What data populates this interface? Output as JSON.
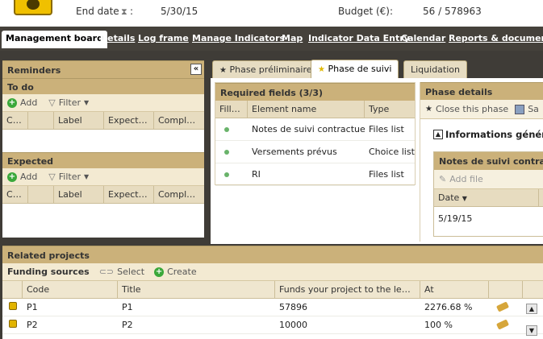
{
  "header": {
    "end_date_label": "End date",
    "end_date_value": "5/30/15",
    "budget_label": "Budget (€):",
    "budget_value": "56 / 578963"
  },
  "nav": {
    "items": [
      "Management board",
      "Details",
      "Log frame",
      "Manage Indicators",
      "Map",
      "Indicator Data Entry",
      "Calendar",
      "Reports & documents"
    ]
  },
  "reminders": {
    "title": "Reminders",
    "collapse_glyph": "«",
    "todo": {
      "title": "To do",
      "add_label": "Add",
      "filter_label": "Filter",
      "columns": [
        "Cl...",
        "",
        "Label",
        "Expecte...",
        "Complet..."
      ]
    },
    "expected": {
      "title": "Expected",
      "add_label": "Add",
      "filter_label": "Filter",
      "columns": [
        "Cl...",
        "",
        "Label",
        "Expecte...",
        "Complet..."
      ]
    }
  },
  "tabs": [
    "Phase préliminaire",
    "Phase de suivi",
    "Liquidation"
  ],
  "required_fields": {
    "title": "Required fields (3/3)",
    "columns": [
      "Fille...",
      "Element name",
      "Type"
    ],
    "rows": [
      {
        "name": "Notes de suivi contractuel",
        "type": "Files list"
      },
      {
        "name": "Versements prévus",
        "type": "Choice list"
      },
      {
        "name": "RI",
        "type": "Files list"
      }
    ]
  },
  "phase_details": {
    "title": "Phase details",
    "close_label": "Close this phase",
    "save_label": "Sa",
    "section_label": "Informations généra",
    "notes_title": "Notes de suivi contractu",
    "add_file_label": "Add file",
    "date_header": "Date",
    "date_value": "5/19/15"
  },
  "related_projects": {
    "title": "Related projects",
    "funding_label": "Funding sources",
    "select_label": "Select",
    "create_label": "Create",
    "columns": [
      "Code",
      "Title",
      "Funds your project to the level o...",
      "At"
    ],
    "rows": [
      {
        "code": "P1",
        "title": "P1",
        "funds": "57896",
        "at": "2276.68 %"
      },
      {
        "code": "P2",
        "title": "P2",
        "funds": "10000",
        "at": "100 %"
      }
    ]
  },
  "colors": {
    "nav_bg": "#45413b",
    "panel_title": "#cbb17a",
    "accent_green": "#3aa83a"
  },
  "icons": [
    "app-logo-icon",
    "hourglass-icon",
    "add-icon",
    "filter-icon",
    "star-icon",
    "disk-icon",
    "collapse-icon",
    "link-icon",
    "coin-icon",
    "edit-icon"
  ]
}
